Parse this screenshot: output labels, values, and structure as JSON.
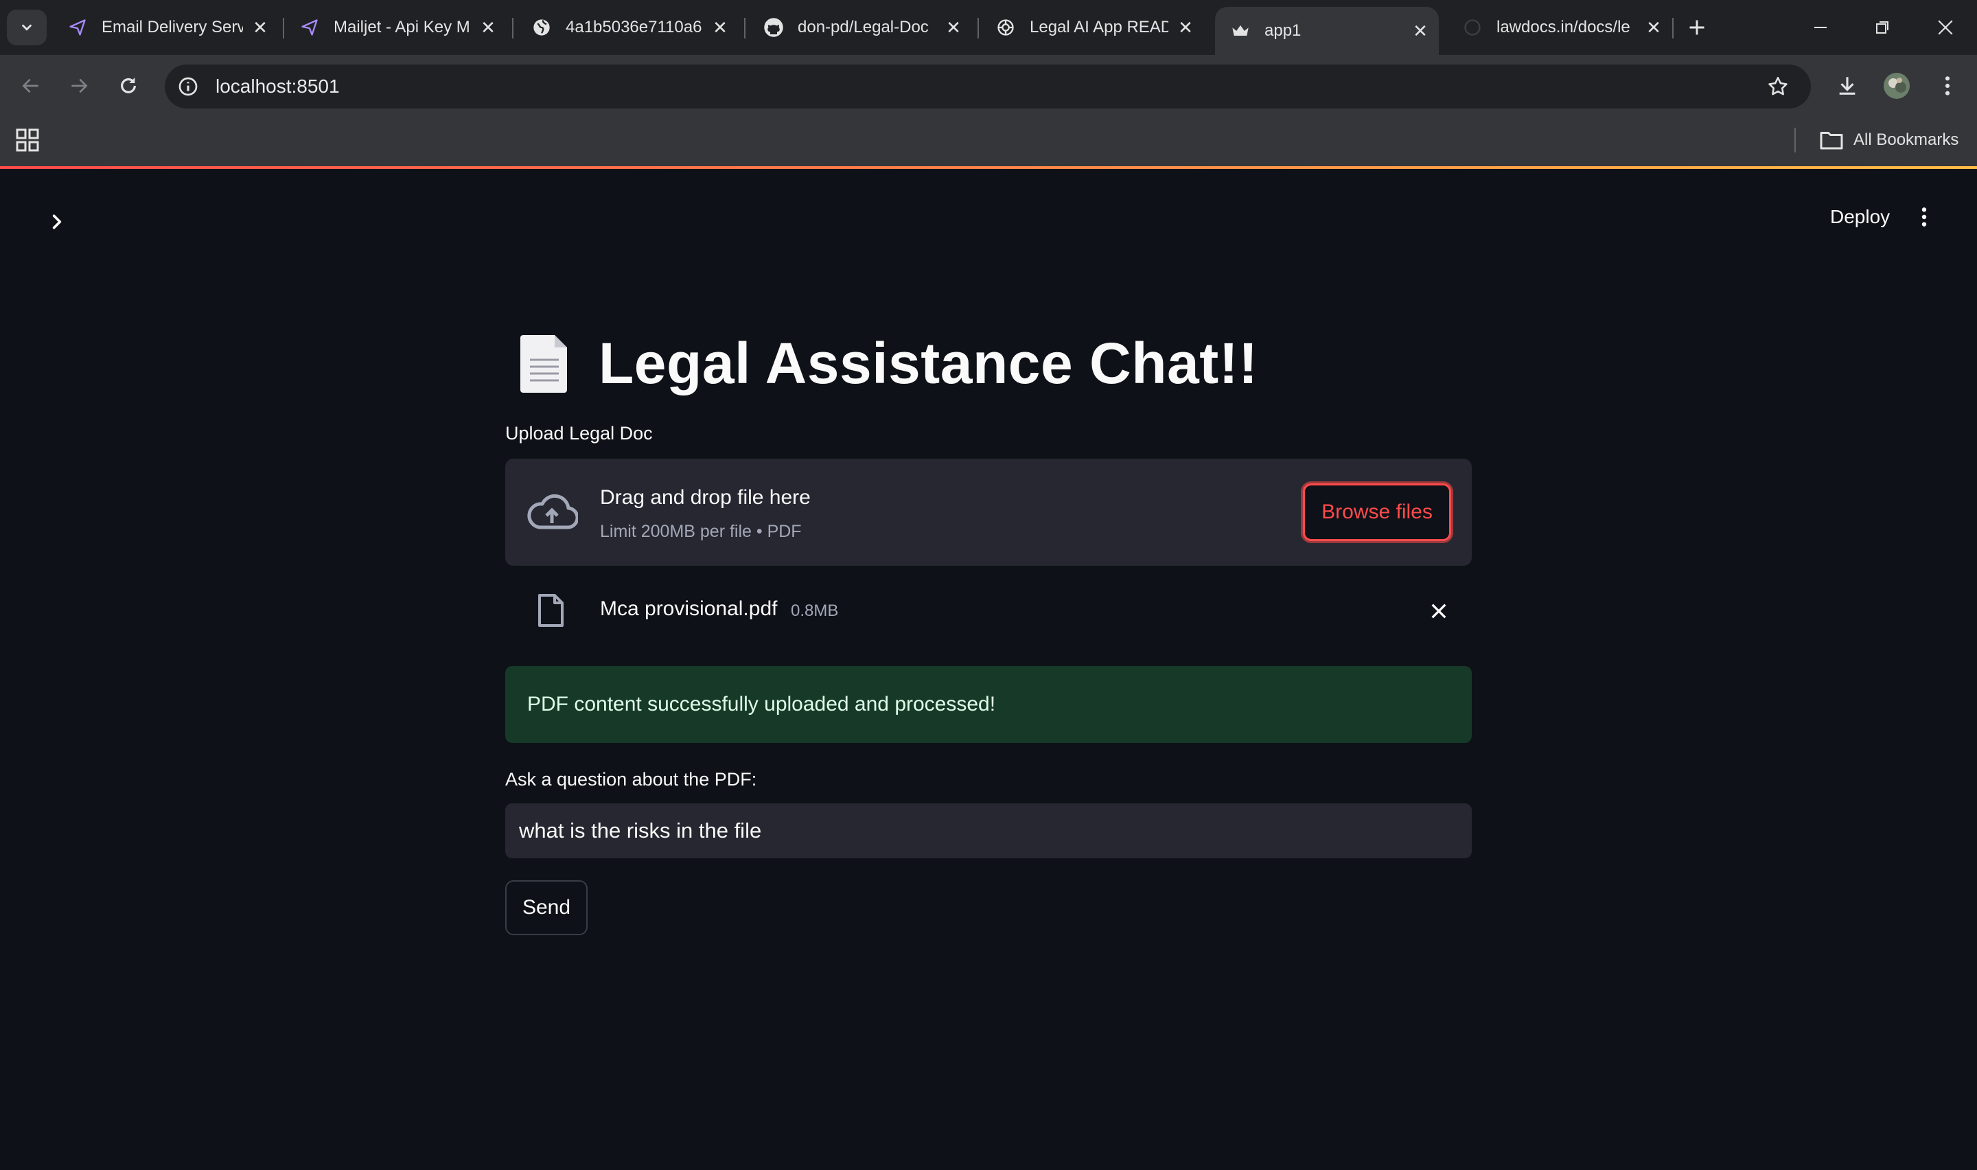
{
  "browser": {
    "tabs": [
      {
        "title": "Email Delivery Serv",
        "icon": "paper-plane-icon"
      },
      {
        "title": "Mailjet - Api Key M",
        "icon": "paper-plane-icon"
      },
      {
        "title": "4a1b5036e7110a6",
        "icon": "globe-icon"
      },
      {
        "title": "don-pd/Legal-Doc",
        "icon": "github-icon"
      },
      {
        "title": "Legal AI App READ",
        "icon": "openai-icon"
      },
      {
        "title": "app1",
        "icon": "streamlit-crown-icon",
        "active": true
      },
      {
        "title": "lawdocs.in/docs/le",
        "icon": "loading-icon"
      }
    ],
    "url": "localhost:8501",
    "all_bookmarks_label": "All Bookmarks"
  },
  "app": {
    "deploy_label": "Deploy",
    "title": "Legal Assistance Chat!!",
    "title_icon": "document-emoji-icon",
    "uploader": {
      "label": "Upload Legal Doc",
      "drag_text": "Drag and drop file here",
      "limit_text": "Limit 200MB per file • PDF",
      "browse_label": "Browse files"
    },
    "uploaded_file": {
      "name": "Mca provisional.pdf",
      "size": "0.8MB"
    },
    "success_message": "PDF content successfully uploaded and processed!",
    "question": {
      "label": "Ask a question about the PDF:",
      "value": "what is the risks in the file"
    },
    "send_label": "Send"
  },
  "colors": {
    "background": "#0e1117",
    "widget_bg": "#262730",
    "accent": "#ff4b4b",
    "success_bg": "#173928"
  }
}
